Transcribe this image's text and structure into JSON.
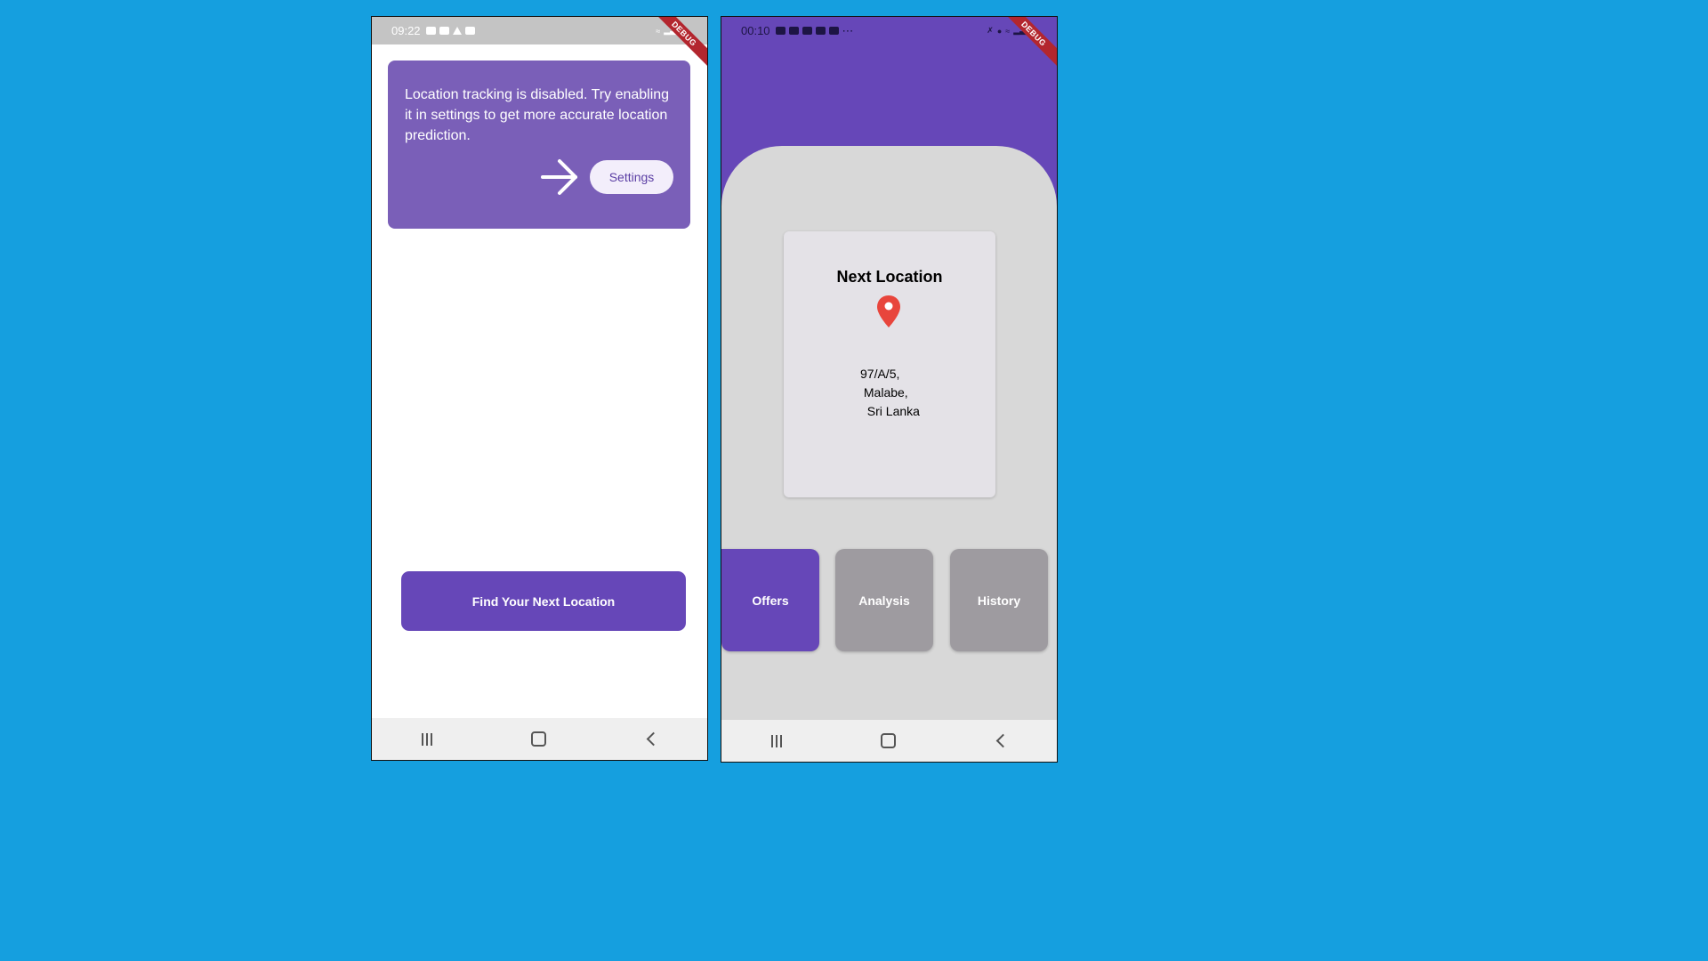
{
  "left_screen": {
    "status_time": "09:22",
    "debug_label": "DEBUG",
    "alert_text": "Location tracking is disabled. Try enabling it in settings to get more accurate location prediction.",
    "settings_label": "Settings",
    "find_button_label": "Find Your Next Location"
  },
  "right_screen": {
    "status_time": "00:10",
    "debug_label": "DEBUG",
    "card_title": "Next Location",
    "address_lines": [
      "97/A/5,",
      " Malabe,",
      "  Sri Lanka"
    ],
    "tabs": [
      {
        "label": "Offers",
        "active": true
      },
      {
        "label": "Analysis",
        "active": false
      },
      {
        "label": "History",
        "active": false
      }
    ]
  },
  "colors": {
    "background": "#159fdf",
    "primary": "#6647b8",
    "alert_card": "#7a5fb8",
    "inactive_tab": "#9e9ba0",
    "pin": "#e8453c"
  },
  "icons": {
    "arrow": "arrow-right-icon",
    "pin": "location-pin-icon",
    "nav": [
      "recent-apps-icon",
      "home-icon",
      "back-icon"
    ]
  }
}
